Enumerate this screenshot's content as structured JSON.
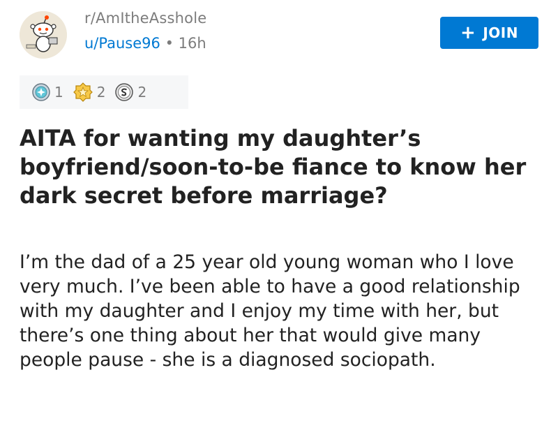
{
  "post": {
    "subreddit": "r/AmItheAsshole",
    "author": "u/Pause96",
    "separator": "•",
    "age": "16h",
    "join_label": "JOIN",
    "awards": [
      {
        "icon": "silver-award-icon",
        "count": "1"
      },
      {
        "icon": "gold-award-icon",
        "count": "2"
      },
      {
        "icon": "platinum-award-icon",
        "count": "2"
      }
    ],
    "title": "AITA for wanting my daughter’s boyfriend/soon-to-be fiance to know her dark secret before marriage?",
    "body": "I’m the dad of a 25 year old young woman who I love very much. I’ve been able to have a good relationship with my daughter and I enjoy my time with her, but there’s one thing about her that would give many people pause - she is a diagnosed sociopath."
  },
  "colors": {
    "accent": "#0079d3",
    "meta": "#7c7c7c",
    "text": "#222222",
    "award_bg": "#f6f7f8"
  }
}
